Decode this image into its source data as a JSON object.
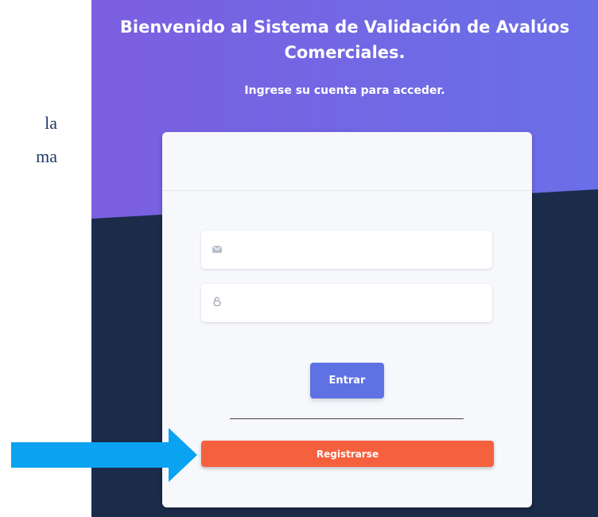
{
  "document": {
    "line_1": "la",
    "line_2": "ma"
  },
  "header": {
    "title": "Bienvenido al Sistema de Validación de Avalúos Comerciales.",
    "subtitle": "Ingrese su cuenta para acceder."
  },
  "form": {
    "email_icon": "envelope-icon",
    "password_icon": "lock-icon",
    "email_value": "",
    "password_value": "",
    "login_label": "Entrar",
    "register_label": "Registrarse"
  },
  "annotation": {
    "arrow_icon": "arrow-right-icon",
    "color": "#0aa3f2"
  },
  "colors": {
    "hero_purple": "#6f66e6",
    "dark_navy": "#1b2b4a",
    "login_button": "#5e72e4",
    "register_button": "#f5613f"
  }
}
